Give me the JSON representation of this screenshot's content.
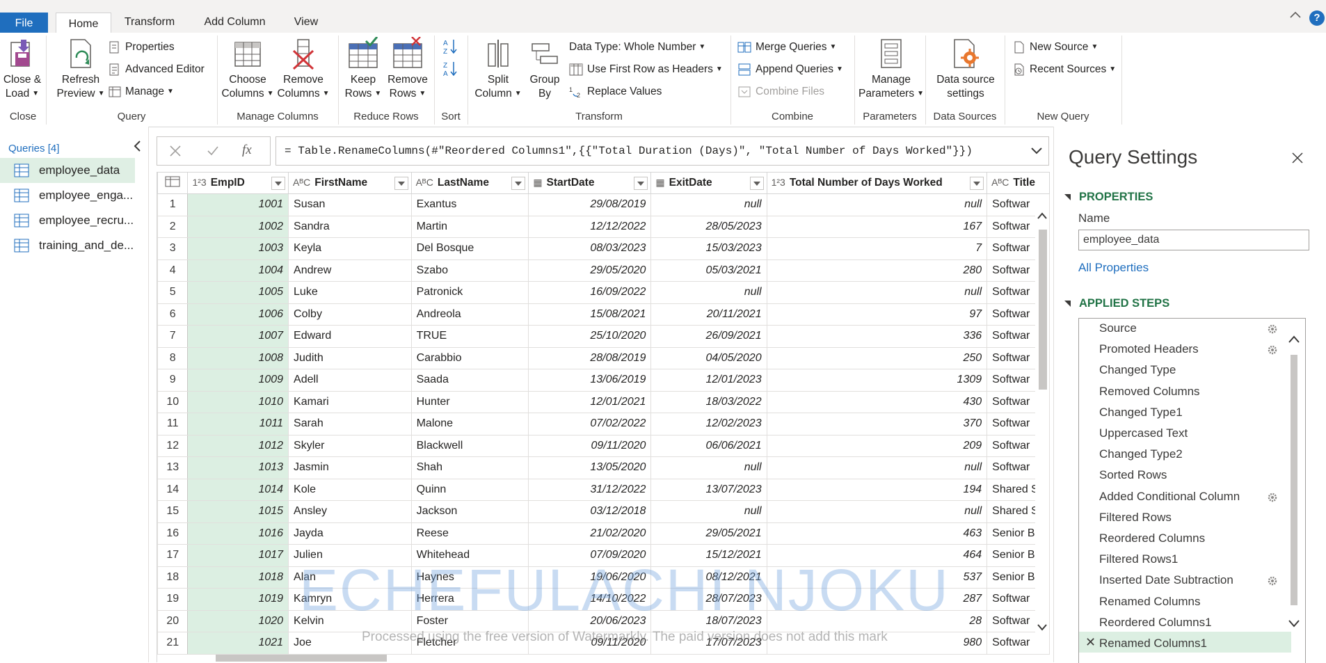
{
  "tabs": {
    "file": "File",
    "home": "Home",
    "transform": "Transform",
    "add_column": "Add Column",
    "view": "View",
    "help": "?"
  },
  "ribbon": {
    "close_load": [
      "Close &",
      "Load"
    ],
    "refresh_preview": [
      "Refresh",
      "Preview"
    ],
    "properties": "Properties",
    "advanced_editor": "Advanced Editor",
    "manage": "Manage",
    "choose_columns": [
      "Choose",
      "Columns"
    ],
    "remove_columns": [
      "Remove",
      "Columns"
    ],
    "keep_rows": [
      "Keep",
      "Rows"
    ],
    "remove_rows": [
      "Remove",
      "Rows"
    ],
    "split_column": [
      "Split",
      "Column"
    ],
    "group_by": [
      "Group",
      "By"
    ],
    "data_type": "Data Type: Whole Number",
    "first_row_headers": "Use First Row as Headers",
    "replace_values": "Replace Values",
    "merge_queries": "Merge Queries",
    "append_queries": "Append Queries",
    "combine_files": "Combine Files",
    "manage_parameters": [
      "Manage",
      "Parameters"
    ],
    "data_source_settings": [
      "Data source",
      "settings"
    ],
    "new_source": "New Source",
    "recent_sources": "Recent Sources",
    "groups": {
      "close": "Close",
      "query": "Query",
      "manage_columns": "Manage Columns",
      "reduce_rows": "Reduce Rows",
      "sort": "Sort",
      "transform": "Transform",
      "combine": "Combine",
      "parameters": "Parameters",
      "data_sources": "Data Sources",
      "new_query": "New Query"
    }
  },
  "queries": {
    "header": "Queries [4]",
    "items": [
      "employee_data",
      "employee_enga...",
      "employee_recru...",
      "training_and_de..."
    ]
  },
  "formula": {
    "fx": "fx",
    "text": "= Table.RenameColumns(#\"Reordered Columns1\",{{\"Total Duration (Days)\", \"Total Number of Days Worked\"}})"
  },
  "grid": {
    "columns": [
      {
        "type": "1²3",
        "name": "EmpID"
      },
      {
        "type": "AᴮC",
        "name": "FirstName"
      },
      {
        "type": "AᴮC",
        "name": "LastName"
      },
      {
        "type": "▦",
        "name": "StartDate"
      },
      {
        "type": "▦",
        "name": "ExitDate"
      },
      {
        "type": "1²3",
        "name": "Total Number of Days Worked"
      },
      {
        "type": "AᴮC",
        "name": "Title"
      }
    ],
    "rows": [
      [
        "1",
        "1001",
        "Susan",
        "Exantus",
        "29/08/2019",
        "null",
        "null",
        "Softwar"
      ],
      [
        "2",
        "1002",
        "Sandra",
        "Martin",
        "12/12/2022",
        "28/05/2023",
        "167",
        "Softwar"
      ],
      [
        "3",
        "1003",
        "Keyla",
        "Del Bosque",
        "08/03/2023",
        "15/03/2023",
        "7",
        "Softwar"
      ],
      [
        "4",
        "1004",
        "Andrew",
        "Szabo",
        "29/05/2020",
        "05/03/2021",
        "280",
        "Softwar"
      ],
      [
        "5",
        "1005",
        "Luke",
        "Patronick",
        "16/09/2022",
        "null",
        "null",
        "Softwar"
      ],
      [
        "6",
        "1006",
        "Colby",
        "Andreola",
        "15/08/2021",
        "20/11/2021",
        "97",
        "Softwar"
      ],
      [
        "7",
        "1007",
        "Edward",
        "TRUE",
        "25/10/2020",
        "26/09/2021",
        "336",
        "Softwar"
      ],
      [
        "8",
        "1008",
        "Judith",
        "Carabbio",
        "28/08/2019",
        "04/05/2020",
        "250",
        "Softwar"
      ],
      [
        "9",
        "1009",
        "Adell",
        "Saada",
        "13/06/2019",
        "12/01/2023",
        "1309",
        "Softwar"
      ],
      [
        "10",
        "1010",
        "Kamari",
        "Hunter",
        "12/01/2021",
        "18/03/2022",
        "430",
        "Softwar"
      ],
      [
        "11",
        "1011",
        "Sarah",
        "Malone",
        "07/02/2022",
        "12/02/2023",
        "370",
        "Softwar"
      ],
      [
        "12",
        "1012",
        "Skyler",
        "Blackwell",
        "09/11/2020",
        "06/06/2021",
        "209",
        "Softwar"
      ],
      [
        "13",
        "1013",
        "Jasmin",
        "Shah",
        "13/05/2020",
        "null",
        "null",
        "Softwar"
      ],
      [
        "14",
        "1014",
        "Kole",
        "Quinn",
        "31/12/2022",
        "13/07/2023",
        "194",
        "Shared S"
      ],
      [
        "15",
        "1015",
        "Ansley",
        "Jackson",
        "03/12/2018",
        "null",
        "null",
        "Shared S"
      ],
      [
        "16",
        "1016",
        "Jayda",
        "Reese",
        "21/02/2020",
        "29/05/2021",
        "463",
        "Senior B"
      ],
      [
        "17",
        "1017",
        "Julien",
        "Whitehead",
        "07/09/2020",
        "15/12/2021",
        "464",
        "Senior B"
      ],
      [
        "18",
        "1018",
        "Alan",
        "Haynes",
        "19/06/2020",
        "08/12/2021",
        "537",
        "Senior B"
      ],
      [
        "19",
        "1019",
        "Kamryn",
        "Herrera",
        "14/10/2022",
        "28/07/2023",
        "287",
        "Softwar"
      ],
      [
        "20",
        "1020",
        "Kelvin",
        "Foster",
        "20/06/2023",
        "18/07/2023",
        "28",
        "Softwar"
      ],
      [
        "21",
        "1021",
        "Joe",
        "Fletcher",
        "09/11/2020",
        "17/07/2023",
        "980",
        "Softwar"
      ]
    ]
  },
  "watermark": {
    "big": "ECHEFULACHI NJOKU",
    "small": "Processed using the free version of Watermarkly. The paid version does not add this mark"
  },
  "settings": {
    "title": "Query Settings",
    "properties_header": "PROPERTIES",
    "name_label": "Name",
    "name_value": "employee_data",
    "all_properties": "All Properties",
    "steps_header": "APPLIED STEPS",
    "steps": [
      {
        "label": "Source",
        "gear": true
      },
      {
        "label": "Promoted Headers",
        "gear": true
      },
      {
        "label": "Changed Type",
        "gear": false
      },
      {
        "label": "Removed Columns",
        "gear": false
      },
      {
        "label": "Changed Type1",
        "gear": false
      },
      {
        "label": "Uppercased Text",
        "gear": false
      },
      {
        "label": "Changed Type2",
        "gear": false
      },
      {
        "label": "Sorted Rows",
        "gear": false
      },
      {
        "label": "Added Conditional Column",
        "gear": true
      },
      {
        "label": "Filtered Rows",
        "gear": false
      },
      {
        "label": "Reordered Columns",
        "gear": false
      },
      {
        "label": "Filtered Rows1",
        "gear": false
      },
      {
        "label": "Inserted Date Subtraction",
        "gear": true
      },
      {
        "label": "Renamed Columns",
        "gear": false
      },
      {
        "label": "Reordered Columns1",
        "gear": false
      },
      {
        "label": "Renamed Columns1",
        "gear": false
      }
    ],
    "selected_step_marker": "✕"
  },
  "colors": {
    "accent_blue": "#1f6ebe",
    "excel_green": "#217346",
    "selection_green": "#dcefe2"
  }
}
